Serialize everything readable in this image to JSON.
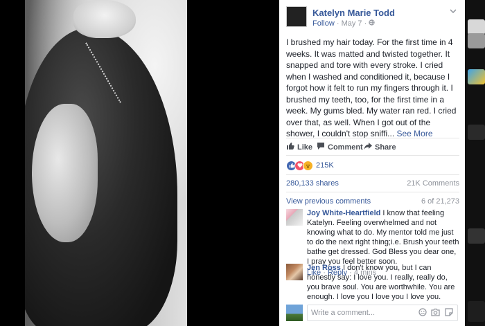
{
  "post": {
    "author": "Katelyn Marie Todd",
    "follow_label": "Follow",
    "date": "May 7",
    "text": "I brushed my hair today. For the first time in 4 weeks. It was matted and twisted together. It snapped and tore with every stroke. I cried when I washed and conditioned it, because I forgot how it felt to run my fingers through it. I brushed my teeth, too, for the first time in a week. My gums bled. My water ran red. I cried over that, as well. When I got out of the shower, I couldn't stop sniffi...",
    "see_more": "See More"
  },
  "actions": {
    "like": "Like",
    "comment": "Comment",
    "share": "Share"
  },
  "reactions": {
    "count": "215K"
  },
  "stats": {
    "shares": "280,133 shares",
    "comments": "21K Comments"
  },
  "comments_header": {
    "view_previous": "View previous comments",
    "position": "6 of 21,273"
  },
  "comments": [
    {
      "author": "Joy White-Heartfield",
      "text": "I know that feeling Katelyn. Feeling overwhelmed and not knowing what to do. My mentor told me just to do the next right thing;i.e. Brush your teeth bathe get dressed. God Bless you dear one, I pray you feel better soon.",
      "like": "Like",
      "reply": "Reply",
      "time": "4 mins"
    },
    {
      "author": "Jen Ross",
      "text": "I don't know you, but I can honestly say: I love you. I really, really do, you brave soul. You are worthwhile. You are enough. I love you I love you I love you."
    }
  ],
  "composer": {
    "placeholder": "Write a comment..."
  },
  "colors": {
    "link": "#365899",
    "meta": "#90949c",
    "like_blue": "#4267b2",
    "love_red": "#f25268",
    "wow_yellow": "#f7b125"
  }
}
